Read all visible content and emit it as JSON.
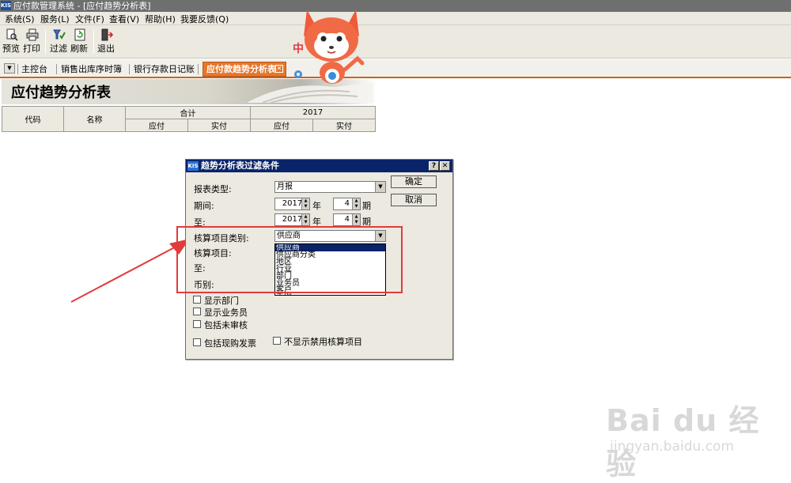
{
  "window": {
    "app_icon": "KIS",
    "title": "应付款管理系统 - [应付趋势分析表]"
  },
  "menu": [
    "系统(S)",
    "服务(L)",
    "文件(F)",
    "查看(V)",
    "帮助(H)",
    "我要反馈(Q)"
  ],
  "toolbar": {
    "preview": "预览",
    "print": "打印",
    "filter": "过滤",
    "refresh": "刷新",
    "exit": "退出"
  },
  "tabs": {
    "main": "主控台",
    "sales_order": "销售出库序时簿",
    "bank": "银行存款日记账",
    "active": "应付款趋势分析表"
  },
  "report": {
    "title": "应付趋势分析表",
    "col_code": "代码",
    "col_name": "名称",
    "group_total": "合计",
    "group_year": "2017",
    "due": "应付",
    "paid": "实付"
  },
  "mascot": {
    "char": "中"
  },
  "dialog": {
    "app_icon": "KIS",
    "title": "趋势分析表过滤条件",
    "help": "?",
    "close": "✕",
    "report_type_label": "报表类型:",
    "report_type_value": "月报",
    "period_label": "期间:",
    "to_label": "至:",
    "period_from": {
      "year": "2017",
      "year_unit": "年",
      "period": "4",
      "period_unit": "期"
    },
    "period_to": {
      "year": "2017",
      "year_unit": "年",
      "period": "4",
      "period_unit": "期"
    },
    "acct_cat_label": "核算项目类别:",
    "acct_cat_value": "供应商",
    "acct_item_label": "核算项目:",
    "acct_to_label": "至:",
    "currency_label": "币别:",
    "dropdown_options": [
      "供应商",
      "供应商分类",
      "地区",
      "行业",
      "部门",
      "业务员",
      "客户",
      "币别"
    ],
    "ok": "确定",
    "cancel": "取消",
    "cb_dept": "显示部门",
    "cb_sales": "显示业务员",
    "cb_unaudited": "包括未审核",
    "cb_purchase_invoice": "包括现购发票",
    "cb_hide_disabled": "不显示禁用核算项目"
  },
  "watermark": {
    "brand": "Bai du 经验",
    "url": "jingyan.baidu.com"
  },
  "colors": {
    "accent_tab": "#e7772a",
    "dialog_title": "#0a246a",
    "highlight": "#e23b3b"
  }
}
